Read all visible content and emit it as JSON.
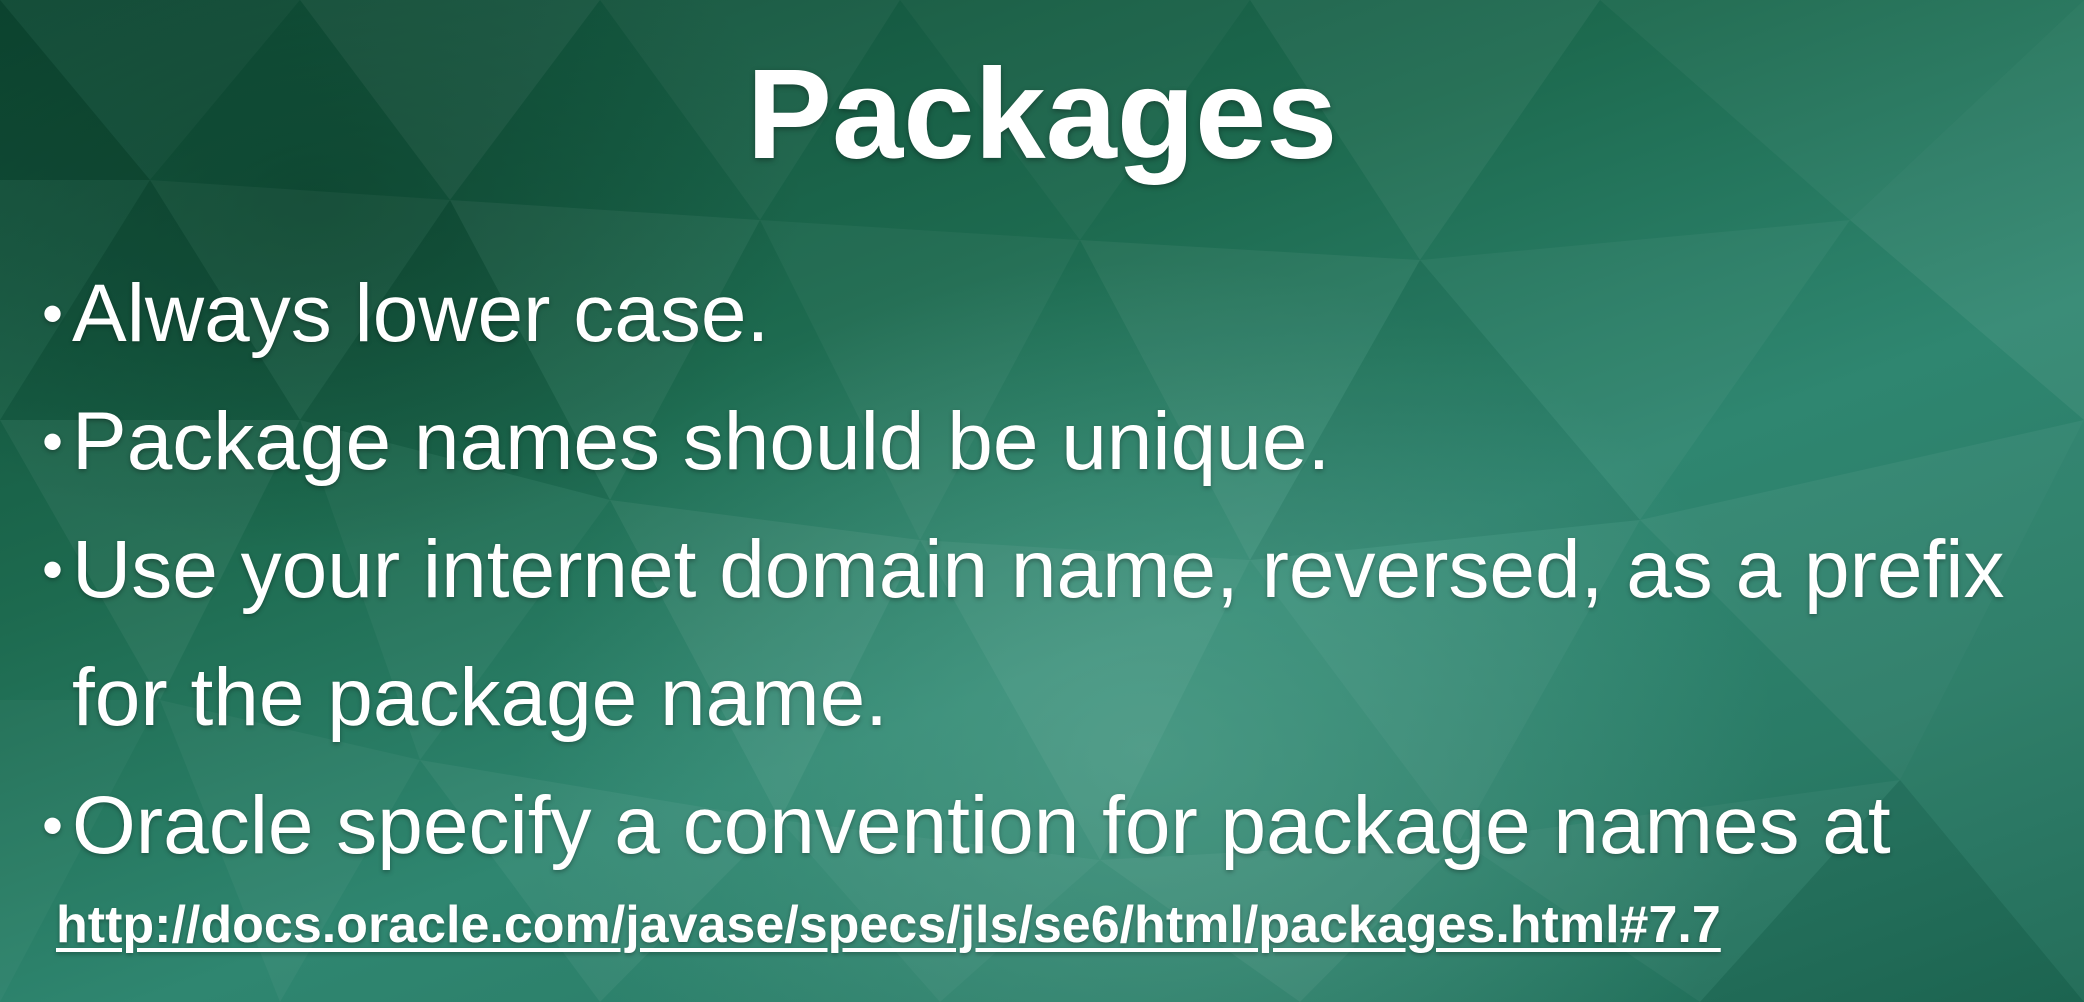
{
  "slide": {
    "title": "Packages",
    "bullets": [
      "Always lower case.",
      "Package names should be unique.",
      "Use your internet domain name, reversed, as a prefix for the package name.",
      "Oracle specify a convention for package names at"
    ],
    "bullet_symbol": "•",
    "link": "http://docs.oracle.com/javase/specs/jls/se6/html/packages.html#7.7"
  },
  "colors": {
    "background_dark": "#0e4a34",
    "background_light": "#2f8670",
    "text": "#ffffff"
  }
}
